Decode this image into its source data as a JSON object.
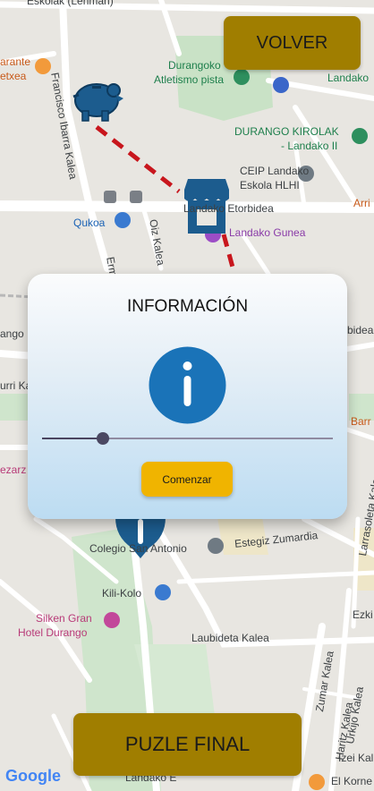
{
  "header": {
    "volver_label": "VOLVER"
  },
  "footer": {
    "puzle_final_label": "PUZLE FINAL"
  },
  "dialog": {
    "title": "INFORMACIÓN",
    "slider_value": 0.21,
    "start_label": "Comenzar"
  },
  "map": {
    "google_logo": "Google",
    "labels": {
      "top_street": "Eskolak (Lehman)",
      "arante": "arante",
      "etxea": "etxea",
      "francisco": "Francisco Ibarra Kalea",
      "durangoko": "Durangoko",
      "atletismo": "Atletismo pista",
      "landako_top": "Landako",
      "kirolak": "DURANGO KIROLAK",
      "landako_ii": "- Landako II",
      "ceip": "CEIP Landako",
      "eskola": "Eskola HLHI",
      "qukoa": "Qukoa",
      "etorbidea": "Landako Etorbidea",
      "landako_gunea": "Landako Gunea",
      "arri": "Arri",
      "oiz": "Oiz Kalea",
      "ermua": "Ermua",
      "urri": "urri Kalea",
      "ango": "ango",
      "bidea": "bidea",
      "barr": "Barr",
      "ezarz": "ezarz",
      "colegio": "Colegio San Antonio",
      "estegiz": "Estegiz Zumardia",
      "larrasoleta": "Larrasoleta Kalea",
      "kili": "Kili-Kolo",
      "silken": "Silken Gran",
      "hotel": "Hotel Durango",
      "laubideta": "Laubideta Kalea",
      "ezki": "Ezki",
      "zumar": "Zumar Kalea",
      "haritz": "Haritz Kalea",
      "urkijo": "Urkijo Kalea",
      "izei": "Izei Kal",
      "el_korne": "El Korne",
      "landako_e": "Landako E"
    }
  },
  "colors": {
    "gold_button": "#a07e00",
    "start_button": "#f0b400",
    "icon_blue": "#1a73b8",
    "route_red": "#c8161d",
    "marker_dark": "#1c5c8e"
  },
  "icons": [
    "piggy-bank-icon",
    "market-stall-icon",
    "map-pin-icon",
    "info-icon"
  ]
}
